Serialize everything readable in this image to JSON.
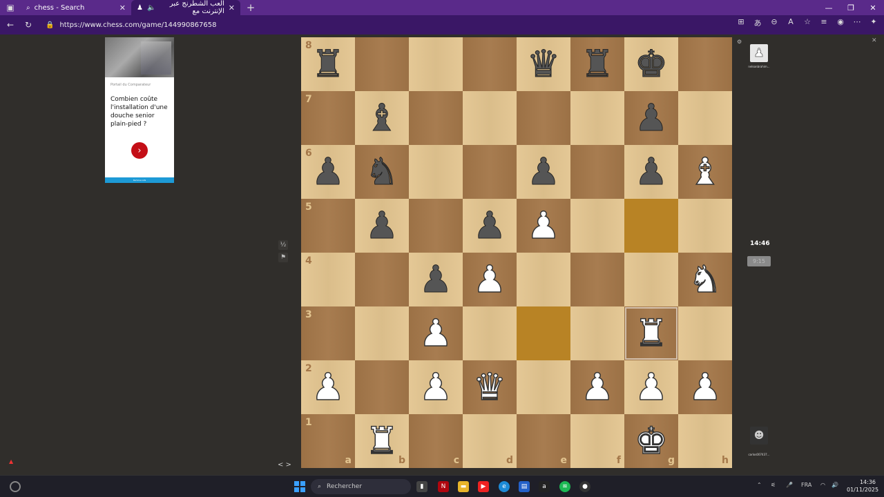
{
  "browser": {
    "tabs": [
      {
        "title": "chess - Search",
        "active": false
      },
      {
        "title": "العب الشطرنج عبر الإنترنت مع",
        "active": true
      }
    ],
    "url": "https://www.chess.com/game/144990867658"
  },
  "ad": {
    "source": "Portail du Comparateur",
    "title": "Combien coûte l'installation d'une douche senior plain-pied ?",
    "button_icon": "chevron-right-icon",
    "footer": "Remove ads"
  },
  "board": {
    "ranks": [
      "8",
      "7",
      "6",
      "5",
      "4",
      "3",
      "2",
      "1"
    ],
    "files": [
      "a",
      "b",
      "c",
      "d",
      "e",
      "f",
      "g",
      "h"
    ],
    "position": [
      [
        "bR",
        "",
        "",
        "",
        "bQ",
        "bR",
        "bK",
        ""
      ],
      [
        "",
        "bB",
        "",
        "",
        "",
        "",
        "bP",
        ""
      ],
      [
        "bP",
        "bN",
        "",
        "",
        "bP",
        "",
        "bP",
        "wB"
      ],
      [
        "",
        "bP",
        "",
        "bP",
        "wP",
        "",
        "",
        ""
      ],
      [
        "",
        "",
        "bP",
        "wP",
        "",
        "",
        "",
        "wN"
      ],
      [
        "",
        "",
        "wP",
        "",
        "",
        "",
        "wR",
        ""
      ],
      [
        "wP",
        "",
        "wP",
        "wQ",
        "",
        "wP",
        "wP",
        "wP"
      ],
      [
        "",
        "wR",
        "",
        "",
        "",
        "",
        "wK",
        ""
      ]
    ],
    "highlighted": [
      "g5",
      "e3"
    ],
    "selected": "g3"
  },
  "players": {
    "top": {
      "name": "nelsonbrahim...",
      "clock": "14:46"
    },
    "bottom": {
      "name": "carlos007437...",
      "clock": "9:15"
    }
  },
  "controls": {
    "draw": "½",
    "resign_icon": "flag-icon",
    "nav": "< >"
  },
  "taskbar": {
    "search_placeholder": "Rechercher",
    "language": "FRA",
    "time": "14:36",
    "date": "01/11/2025"
  },
  "colors": {
    "light_square": "#e3c590",
    "dark_square": "#a47749",
    "highlight": "#d2a12d",
    "browser_frame": "#5a2a8a"
  }
}
